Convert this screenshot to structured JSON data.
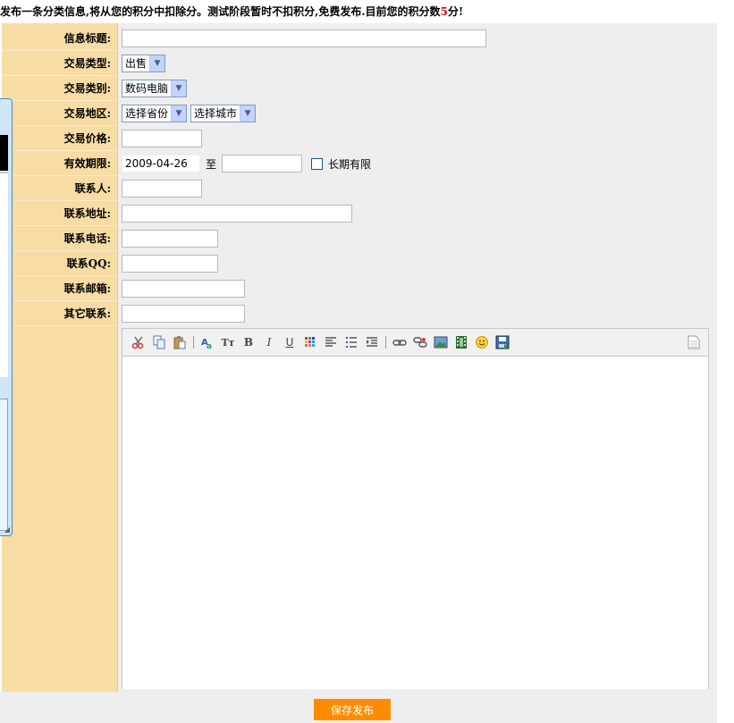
{
  "notice": {
    "prefix": "发布一条分类信息,将从您的积分中扣除分。测试阶段暂时不扣积分,免费发布.目前您的积分数",
    "points": "5",
    "suffix": "分!"
  },
  "form": {
    "labels": {
      "title": "信息标题:",
      "trade_type": "交易类型:",
      "trade_category": "交易类别:",
      "trade_region": "交易地区:",
      "trade_price": "交易价格:",
      "valid_period": "有效期限:",
      "contact_person": "联系人:",
      "contact_address": "联系地址:",
      "contact_phone": "联系电话:",
      "contact_qq": "联系QQ:",
      "contact_email": "联系邮箱:",
      "other_contact": "其它联系:"
    },
    "values": {
      "title": "",
      "trade_type": "出售",
      "trade_category": "数码电脑",
      "province": "选择省份",
      "city": "选择城市",
      "price": "",
      "valid_from": "2009-04-26",
      "valid_to_sep": "至",
      "valid_to": "",
      "long_term_label": "长期有限",
      "contact_person": "",
      "contact_address": "",
      "contact_phone": "",
      "contact_qq": "",
      "contact_email": "",
      "other_contact": ""
    }
  },
  "editor": {
    "icons": [
      "scissors-icon",
      "copy-icon",
      "paste-icon",
      "find-replace-icon",
      "font-size-icon",
      "bold-icon",
      "italic-icon",
      "underline-icon",
      "color-grid-icon",
      "align-left-icon",
      "bullet-list-icon",
      "indent-icon",
      "link-icon",
      "unlink-icon",
      "image-icon",
      "media-icon",
      "emoticon-icon",
      "save-icon",
      "document-icon"
    ],
    "bold_glyph": "B",
    "italic_glyph": "I",
    "underline_glyph": "U",
    "fontsize_glyph": "Tт"
  },
  "actions": {
    "save_label": "保存发布"
  },
  "colors": {
    "label_column": "#f7dca4",
    "form_bg": "#eeeeee",
    "save_button": "#ff8c00",
    "points_red": "#d40000"
  }
}
